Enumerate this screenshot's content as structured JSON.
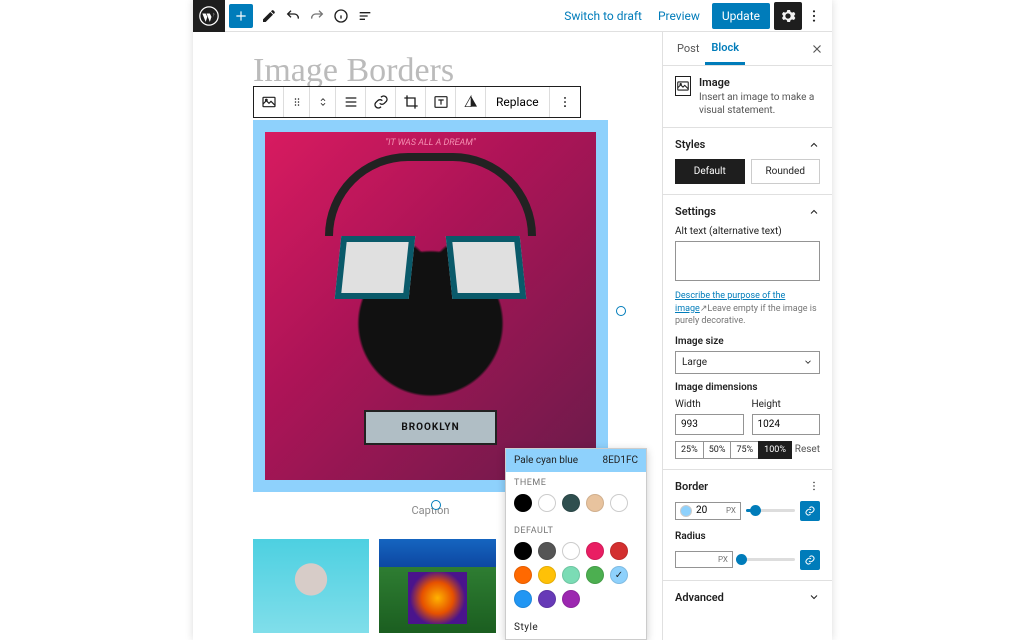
{
  "topbar": {
    "switch_draft": "Switch to draft",
    "preview": "Preview",
    "update": "Update"
  },
  "page": {
    "title": "Image Borders",
    "caption": "Caption"
  },
  "block_toolbar": {
    "replace": "Replace"
  },
  "color_popover": {
    "name": "Pale cyan blue",
    "hex": "8ED1FC",
    "theme_label": "THEME",
    "default_label": "DEFAULT",
    "style_label": "Style",
    "theme_colors": [
      "#000000",
      "#ffffff",
      "#2f4f4f",
      "#e8c39e",
      "#ffffff"
    ],
    "default_colors": [
      "#000000",
      "#555555",
      "#ffffff",
      "#e91e63",
      "#d32f2f",
      "#ff6900",
      "#ffc107",
      "#7bdcb5",
      "#4caf50",
      "#8ed1fc",
      "#2196f3",
      "#673ab7",
      "#9c27b0"
    ],
    "selected_default": "#8ed1fc"
  },
  "sidebar": {
    "tab_post": "Post",
    "tab_block": "Block",
    "block": {
      "name": "Image",
      "desc": "Insert an image to make a visual statement."
    },
    "styles": {
      "heading": "Styles",
      "default": "Default",
      "rounded": "Rounded"
    },
    "settings": {
      "heading": "Settings",
      "alt_label": "Alt text (alternative text)",
      "alt_help_link": "Describe the purpose of the image",
      "alt_help_rest": "Leave empty if the image is purely decorative.",
      "size_label": "Image size",
      "size_value": "Large",
      "dim_label": "Image dimensions",
      "width_label": "Width",
      "height_label": "Height",
      "width": "993",
      "height": "1024",
      "pcts": [
        "25%",
        "50%",
        "75%",
        "100%"
      ],
      "pct_active": "100%",
      "reset": "Reset"
    },
    "border": {
      "heading": "Border",
      "value": "20",
      "unit": "PX",
      "radius_label": "Radius",
      "radius_value": "",
      "radius_unit": "PX"
    },
    "advanced": {
      "heading": "Advanced"
    }
  }
}
